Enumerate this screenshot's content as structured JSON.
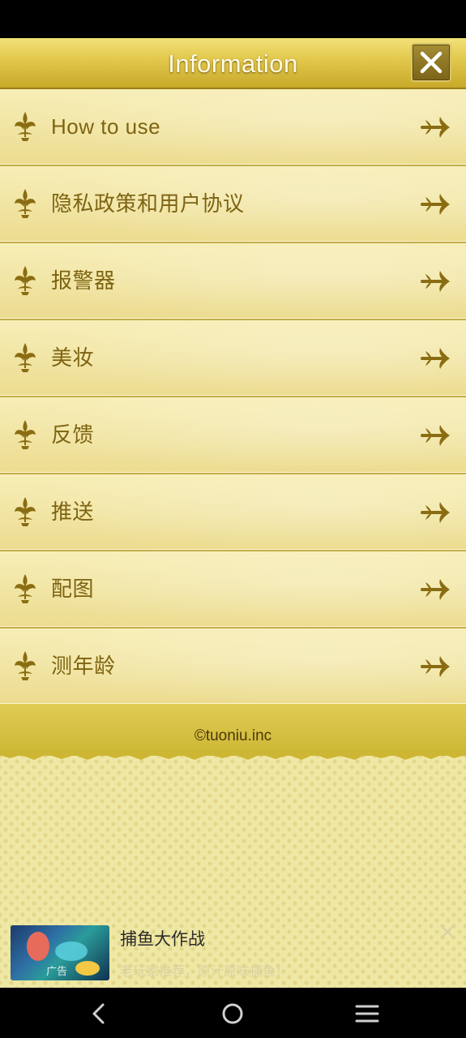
{
  "header": {
    "title": "Information",
    "close_icon": "close-icon"
  },
  "menu": {
    "items": [
      {
        "label": "How to use"
      },
      {
        "label": "隐私政策和用户协议"
      },
      {
        "label": "报警器"
      },
      {
        "label": "美妆"
      },
      {
        "label": "反馈"
      },
      {
        "label": "推送"
      },
      {
        "label": "配图"
      },
      {
        "label": "测年龄"
      }
    ],
    "leading_icon": "fleur-de-lis-icon",
    "trailing_icon": "arrow-right-icon"
  },
  "footer": {
    "copyright": "©tuoniu.inc"
  },
  "ad": {
    "badge": "广告",
    "title": "捕鱼大作战",
    "description": "老玩家推荐，原汁原味捕鱼！",
    "close_icon": "close-icon"
  },
  "nav": {
    "icons": [
      "back-icon",
      "home-icon",
      "menu-icon"
    ]
  },
  "colors": {
    "header_gold": "#e3c94e",
    "item_bg": "#f4e9a8",
    "item_text": "#7d6412",
    "footer_gold": "#d6c040"
  }
}
